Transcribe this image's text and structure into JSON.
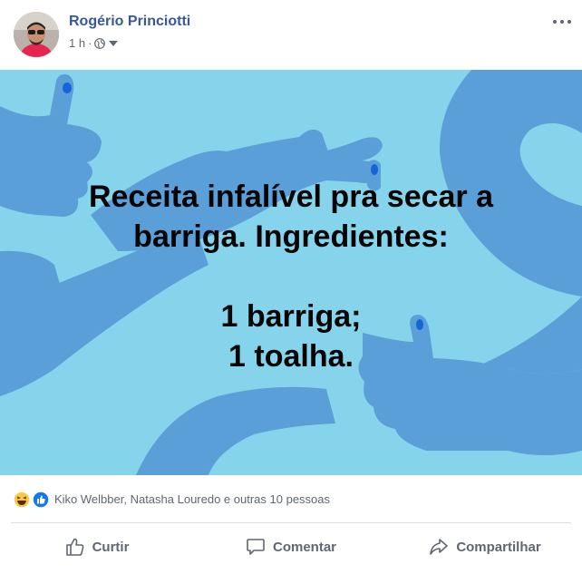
{
  "post": {
    "author": "Rogério Princiotti",
    "time": "1 h",
    "separator": "·",
    "photo_text": "Receita infalível pra secar a barriga. Ingredientes:\n\n1 barriga;\n1 toalha.",
    "reactions_text": "Kiko Welbber, Natasha Louredo e outras 10 pessoas"
  },
  "actions": {
    "like": "Curtir",
    "comment": "Comentar",
    "share": "Compartilhar"
  },
  "icons": {
    "privacy": "globe-icon",
    "audience_menu": "caret-down-icon",
    "options": "more-options-icon",
    "reaction_1": "haha-reaction-icon",
    "reaction_2": "like-reaction-icon"
  },
  "colors": {
    "author_link": "#385898",
    "photo_background": "#86d4ec",
    "hands": "#5b9fd8",
    "like_blue": "#1877f2",
    "secondary_text": "#606770"
  }
}
